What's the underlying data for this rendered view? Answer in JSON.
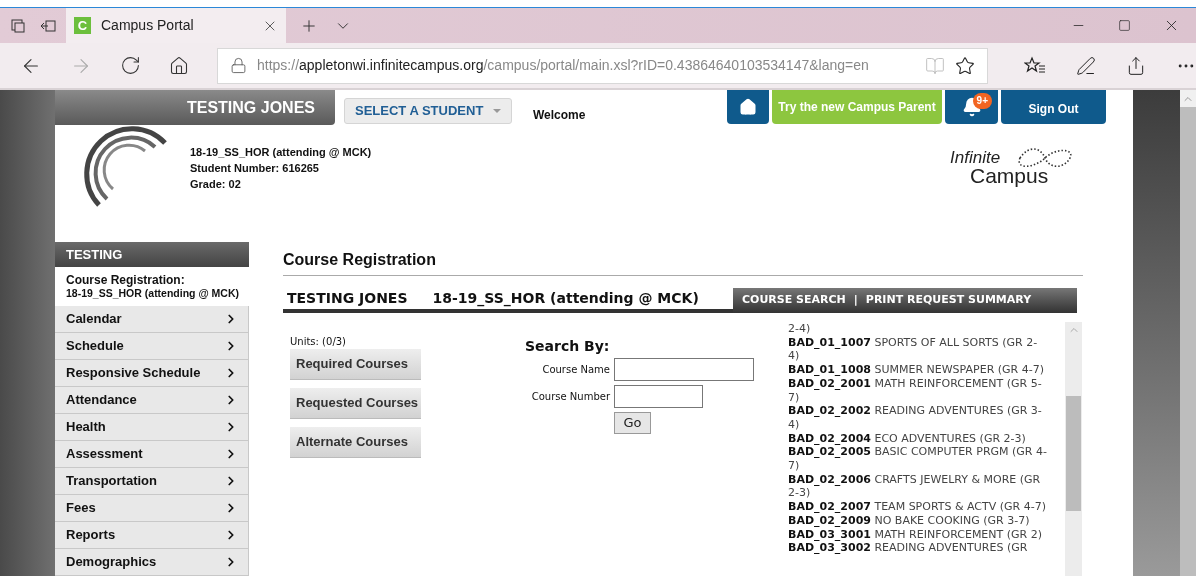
{
  "browser": {
    "tabs": [
      {
        "favicon": "C",
        "title": "Campus Portal",
        "selected": true
      }
    ],
    "address": {
      "scheme": "https://",
      "host": "appletonwi.infinitecampus.org",
      "path": "/campus/portal/main.xsl?rID=0.43864640103534147&lang=en"
    }
  },
  "header": {
    "student_name": "TESTING JONES",
    "select_button": "SELECT A STUDENT",
    "welcome": "Welcome",
    "campus_parent_button": "Try the new Campus Parent",
    "notification_badge": "9+",
    "sign_out": "Sign Out",
    "student_info": [
      "18-19_SS_HOR (attending @ MCK)",
      "Student Number: 616265",
      "Grade: 02"
    ],
    "logo": {
      "line_1": "Infinite",
      "line_2": "Campus"
    }
  },
  "sidebar": {
    "title": "TESTING",
    "context_title": "Course Registration:",
    "context_detail": "18-19_SS_HOR (attending @ MCK)",
    "items": [
      "Calendar",
      "Schedule",
      "Responsive Schedule",
      "Attendance",
      "Health",
      "Assessment",
      "Transportation",
      "Fees",
      "Reports",
      "Demographics"
    ]
  },
  "main": {
    "title": "Course Registration",
    "student_name": "TESTING JONES",
    "calendar": "18-19_SS_HOR (attending @ MCK)",
    "links": [
      "COURSE SEARCH",
      "PRINT REQUEST SUMMARY"
    ],
    "link_separator": "|",
    "units": "Units: (0/3)",
    "course_buttons": [
      "Required Courses",
      "Requested Courses",
      "Alternate Courses"
    ],
    "search": {
      "title": "Search By:",
      "fields": [
        {
          "label": "Course Name",
          "kind": "wide"
        },
        {
          "label": "Course Number",
          "kind": "narrow"
        }
      ],
      "go_button": "Go"
    },
    "courses": [
      {
        "kind": "fragment",
        "title": "2-4)"
      },
      {
        "kind": "course",
        "code": "BAD_01_1007",
        "title": "SPORTS OF ALL SORTS (GR 2-4)"
      },
      {
        "kind": "course",
        "code": "BAD_01_1008",
        "title": "SUMMER NEWSPAPER (GR 4-7)"
      },
      {
        "kind": "course",
        "code": "BAD_02_2001",
        "title": "MATH REINFORCEMENT (GR 5-7)"
      },
      {
        "kind": "course",
        "code": "BAD_02_2002",
        "title": "READING ADVENTURES (GR 3-4)"
      },
      {
        "kind": "course",
        "code": "BAD_02_2004",
        "title": "ECO ADVENTURES (GR 2-3)"
      },
      {
        "kind": "course",
        "code": "BAD_02_2005",
        "title": "BASIC COMPUTER PRGM (GR 4-7)"
      },
      {
        "kind": "course",
        "code": "BAD_02_2006",
        "title": "CRAFTS JEWELRY & MORE (GR 2-3)"
      },
      {
        "kind": "course",
        "code": "BAD_02_2007",
        "title": "TEAM SPORTS & ACTV (GR 4-7)"
      },
      {
        "kind": "course",
        "code": "BAD_02_2009",
        "title": "NO BAKE COOKING (GR 3-7)"
      },
      {
        "kind": "course",
        "code": "BAD_03_3001",
        "title": "MATH REINFORCEMENT (GR 2)"
      },
      {
        "kind": "course",
        "code": "BAD_03_3002",
        "title": "READING ADVENTURES (GR"
      }
    ]
  }
}
